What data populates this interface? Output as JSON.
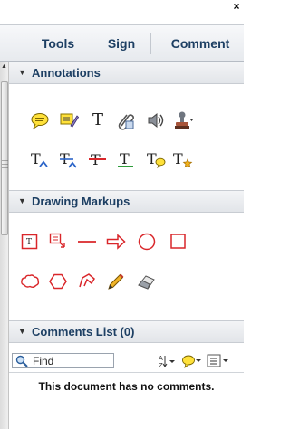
{
  "window": {
    "close_glyph": "×"
  },
  "tabs": [
    {
      "label": "Tools"
    },
    {
      "label": "Sign"
    },
    {
      "label": "Comment"
    }
  ],
  "panels": {
    "annotations": {
      "title": "Annotations",
      "tools": [
        "sticky-note-icon",
        "highlight-text-icon",
        "add-text-icon",
        "attach-file-icon",
        "record-audio-icon",
        "stamp-icon",
        "insert-text-icon",
        "replace-text-icon",
        "strikethrough-icon",
        "underline-icon",
        "add-note-to-text-icon",
        "text-correction-markup-icon"
      ],
      "text_glyphs": {
        "add_text": "T"
      }
    },
    "drawing_markups": {
      "title": "Drawing Markups",
      "tools": [
        "text-box-icon",
        "text-callout-icon",
        "line-icon",
        "arrow-icon",
        "oval-icon",
        "rectangle-icon",
        "cloud-icon",
        "polygon-icon",
        "connected-lines-icon",
        "pencil-icon",
        "eraser-icon"
      ]
    },
    "comments_list": {
      "title": "Comments List (0)",
      "find_label": "Find",
      "empty_message": "This document has no comments."
    }
  },
  "colors": {
    "tab_text": "#1d3f63",
    "markup_red": "#d9262a",
    "note_yellow": "#ffe13a"
  }
}
